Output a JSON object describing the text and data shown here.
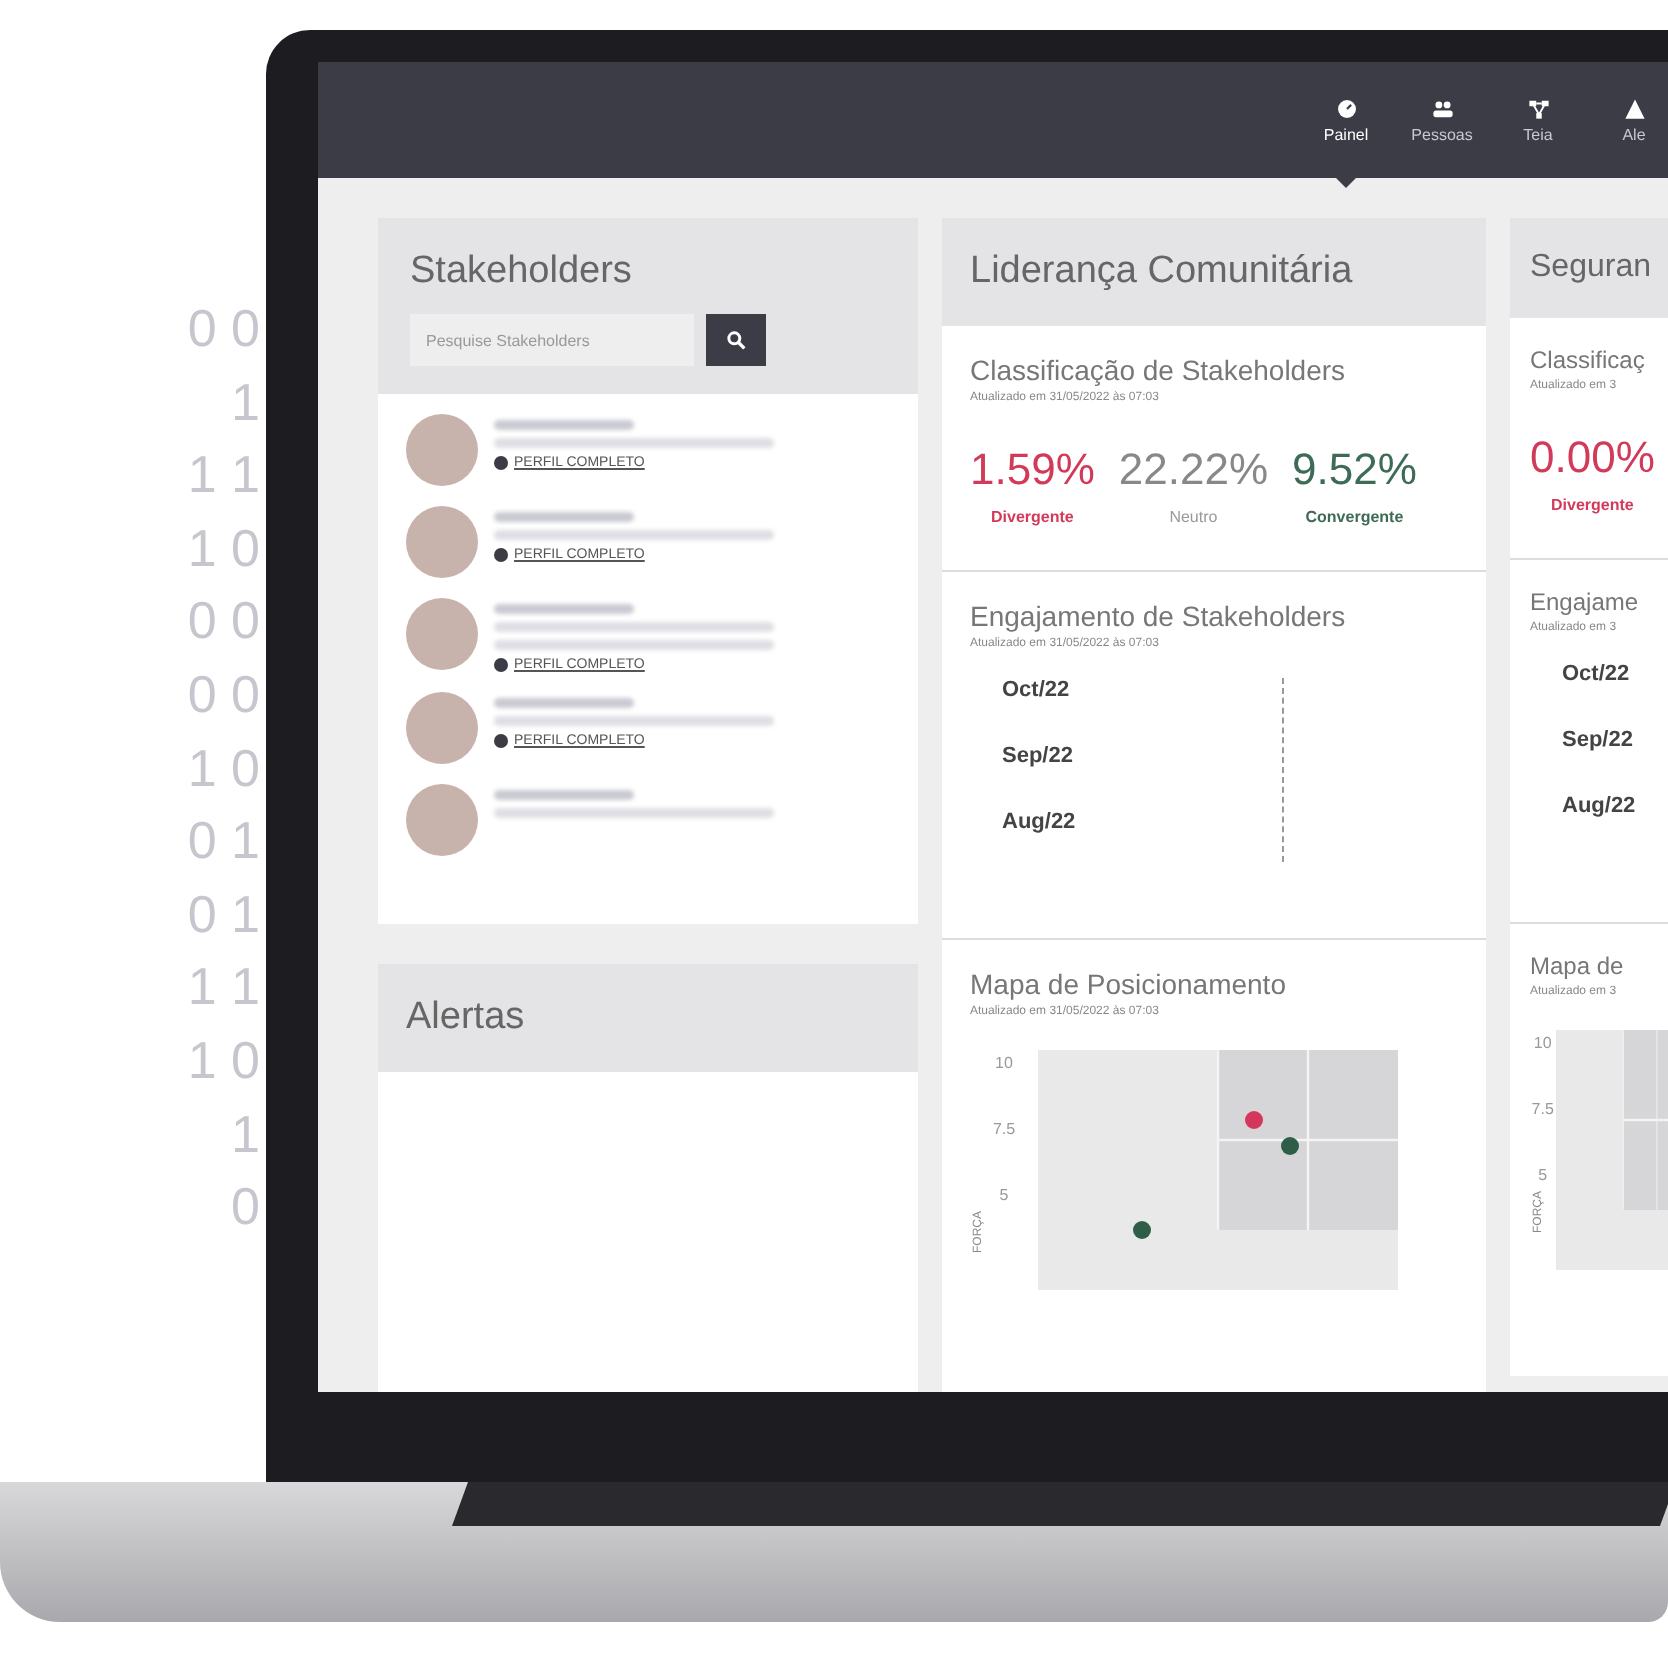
{
  "decor_digits": [
    "0 0",
    "1",
    "1 1",
    "1 0",
    "0 0",
    "0 0",
    "1 0",
    "0 1",
    "0 1",
    "1 1",
    "1 0",
    "1",
    "0"
  ],
  "nav": [
    {
      "label": "Painel",
      "selected": true
    },
    {
      "label": "Pessoas",
      "selected": false
    },
    {
      "label": "Teia",
      "selected": false
    },
    {
      "label": "Ale",
      "selected": false
    }
  ],
  "stakeholders": {
    "title": "Stakeholders",
    "search": {
      "placeholder": "Pesquise Stakeholders"
    },
    "profile_links": [
      "PERFIL COMPLETO",
      "PERFIL COMPLETO",
      "PERFIL COMPLETO",
      "PERFIL COMPLETO"
    ]
  },
  "alerts": {
    "title": "Alertas"
  },
  "dashboards": [
    {
      "title": "Liderança Comunitária",
      "classification": {
        "title": "Classificação de Stakeholders",
        "updated": "Atualizado em 31/05/2022 às 07:03",
        "metrics": [
          {
            "value": "1.59%",
            "label": "Divergente",
            "kind": "divergent"
          },
          {
            "value": "22.22%",
            "label": "Neutro",
            "kind": "neutral"
          },
          {
            "value": "9.52%",
            "label": "Convergente",
            "kind": "convergent"
          }
        ]
      },
      "engagement": {
        "title": "Engajamento de Stakeholders",
        "updated": "Atualizado em 31/05/2022 às 07:03",
        "months": [
          "Oct/22",
          "Sep/22",
          "Aug/22"
        ]
      },
      "map": {
        "title": "Mapa de Posicionamento",
        "updated": "Atualizado em 31/05/2022 às 07:03",
        "yticks": [
          "10",
          "7.5",
          "5"
        ],
        "axis_label": "FORÇA"
      }
    },
    {
      "title": "Seguran",
      "classification": {
        "title": "Classificaç",
        "updated": "Atualizado em 3",
        "metrics": [
          {
            "value": "0.00%",
            "label": "Divergente",
            "kind": "divergent"
          }
        ]
      },
      "engagement": {
        "title": "Engajame",
        "updated": "Atualizado em 3",
        "months": [
          "Oct/22",
          "Sep/22",
          "Aug/22"
        ]
      },
      "map": {
        "title": "Mapa de",
        "updated": "Atualizado em 3",
        "yticks": [
          "10",
          "7.5",
          "5"
        ],
        "axis_label": "FORÇA"
      }
    }
  ]
}
